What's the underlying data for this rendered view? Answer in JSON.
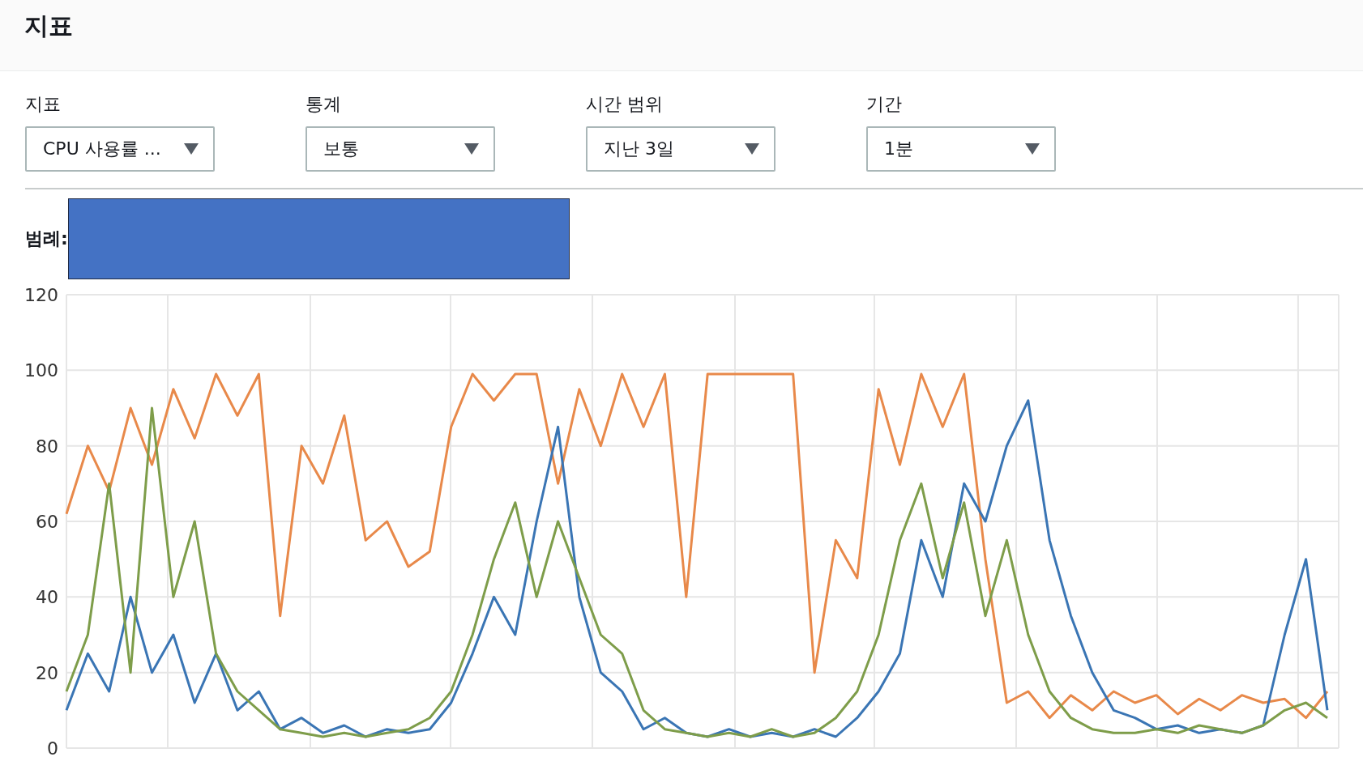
{
  "header": {
    "title": "지표"
  },
  "filters": [
    {
      "label": "지표",
      "value": "CPU 사용률 ..."
    },
    {
      "label": "통계",
      "value": "보통"
    },
    {
      "label": "시간 범위",
      "value": "지난 3일"
    },
    {
      "label": "기간",
      "value": "1분"
    }
  ],
  "legend": {
    "label": "범례:"
  },
  "chart": {
    "chart_data": {
      "type": "line",
      "grid": true,
      "ylim": [
        0,
        120
      ],
      "yticks": [
        0,
        20,
        40,
        60,
        80,
        100,
        120
      ],
      "series": [
        {
          "color": "#e8894a",
          "values": [
            62,
            80,
            68,
            90,
            75,
            95,
            82,
            99,
            88,
            99,
            35,
            80,
            70,
            88,
            55,
            60,
            48,
            52,
            85,
            99,
            92,
            99,
            99,
            70,
            95,
            80,
            99,
            85,
            99,
            40,
            99,
            99,
            99,
            99,
            99,
            20,
            55,
            45,
            95,
            75,
            99,
            85,
            99,
            50,
            12,
            15,
            8,
            14,
            10,
            15,
            12,
            14,
            9,
            13,
            10,
            14,
            12,
            13,
            8,
            15
          ]
        },
        {
          "color": "#3a75b4",
          "values": [
            10,
            25,
            15,
            40,
            20,
            30,
            12,
            25,
            10,
            15,
            5,
            8,
            4,
            6,
            3,
            5,
            4,
            5,
            12,
            25,
            40,
            30,
            60,
            85,
            40,
            20,
            15,
            5,
            8,
            4,
            3,
            5,
            3,
            4,
            3,
            5,
            3,
            8,
            15,
            25,
            55,
            40,
            70,
            60,
            80,
            92,
            55,
            35,
            20,
            10,
            8,
            5,
            6,
            4,
            5,
            4,
            6,
            30,
            50,
            10
          ]
        },
        {
          "color": "#7e9d4a",
          "values": [
            15,
            30,
            70,
            20,
            90,
            40,
            60,
            25,
            15,
            10,
            5,
            4,
            3,
            4,
            3,
            4,
            5,
            8,
            15,
            30,
            50,
            65,
            40,
            60,
            45,
            30,
            25,
            10,
            5,
            4,
            3,
            4,
            3,
            5,
            3,
            4,
            8,
            15,
            30,
            55,
            70,
            45,
            65,
            35,
            55,
            30,
            15,
            8,
            5,
            4,
            4,
            5,
            4,
            6,
            5,
            4,
            6,
            10,
            12,
            8
          ]
        }
      ]
    }
  }
}
